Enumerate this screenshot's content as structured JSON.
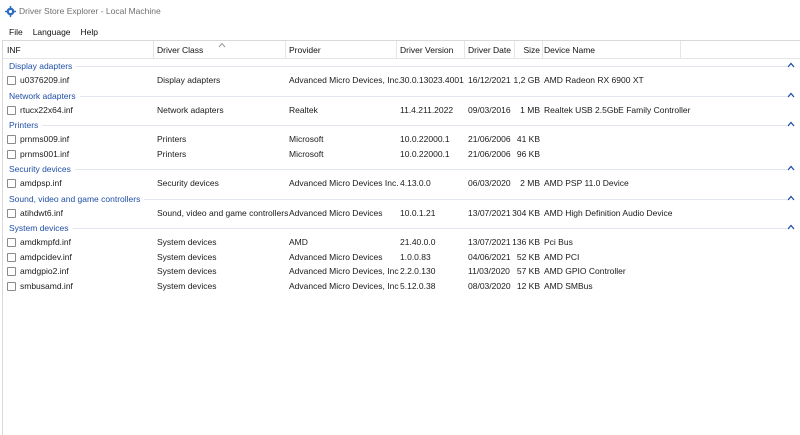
{
  "window": {
    "title": "Driver Store Explorer - Local Machine"
  },
  "menu": [
    "File",
    "Language",
    "Help"
  ],
  "columns": {
    "inf": "INF",
    "driver_class": "Driver Class",
    "provider": "Provider",
    "driver_version": "Driver Version",
    "driver_date": "Driver Date",
    "size": "Size",
    "device_name": "Device Name"
  },
  "groups": [
    {
      "label": "Display adapters",
      "rows": [
        {
          "inf": "u0376209.inf",
          "class": "Display adapters",
          "provider": "Advanced Micro Devices, Inc.",
          "version": "30.0.13023.4001",
          "date": "16/12/2021",
          "size": "1,2 GB",
          "device": "AMD Radeon RX 6900 XT"
        }
      ]
    },
    {
      "label": "Network adapters",
      "rows": [
        {
          "inf": "rtucx22x64.inf",
          "class": "Network adapters",
          "provider": "Realtek",
          "version": "11.4.211.2022",
          "date": "09/03/2016",
          "size": "1 MB",
          "device": "Realtek USB 2.5GbE Family Controller"
        }
      ]
    },
    {
      "label": "Printers",
      "rows": [
        {
          "inf": "prnms009.inf",
          "class": "Printers",
          "provider": "Microsoft",
          "version": "10.0.22000.1",
          "date": "21/06/2006",
          "size": "41 KB",
          "device": ""
        },
        {
          "inf": "prnms001.inf",
          "class": "Printers",
          "provider": "Microsoft",
          "version": "10.0.22000.1",
          "date": "21/06/2006",
          "size": "96 KB",
          "device": ""
        }
      ]
    },
    {
      "label": "Security devices",
      "rows": [
        {
          "inf": "amdpsp.inf",
          "class": "Security devices",
          "provider": "Advanced Micro Devices Inc.",
          "version": "4.13.0.0",
          "date": "06/03/2020",
          "size": "2 MB",
          "device": "AMD PSP 11.0 Device"
        }
      ]
    },
    {
      "label": "Sound, video and game controllers",
      "rows": [
        {
          "inf": "atihdwt6.inf",
          "class": "Sound, video and game controllers",
          "provider": "Advanced Micro Devices",
          "version": "10.0.1.21",
          "date": "13/07/2021",
          "size": "304 KB",
          "device": "AMD High Definition Audio Device"
        }
      ]
    },
    {
      "label": "System devices",
      "rows": [
        {
          "inf": "amdkmpfd.inf",
          "class": "System devices",
          "provider": "AMD",
          "version": "21.40.0.0",
          "date": "13/07/2021",
          "size": "136 KB",
          "device": "Pci Bus"
        },
        {
          "inf": "amdpcidev.inf",
          "class": "System devices",
          "provider": "Advanced Micro Devices",
          "version": "1.0.0.83",
          "date": "04/06/2021",
          "size": "52 KB",
          "device": "AMD PCI"
        },
        {
          "inf": "amdgpio2.inf",
          "class": "System devices",
          "provider": "Advanced Micro Devices, Inc",
          "version": "2.2.0.130",
          "date": "11/03/2020",
          "size": "57 KB",
          "device": "AMD GPIO Controller"
        },
        {
          "inf": "smbusamd.inf",
          "class": "System devices",
          "provider": "Advanced Micro Devices, Inc",
          "version": "5.12.0.38",
          "date": "08/03/2020",
          "size": "12 KB",
          "device": "AMD SMBus"
        }
      ]
    }
  ],
  "colors": {
    "group_text": "#1f4fa6",
    "accent_chevron": "#1f4fa6"
  }
}
